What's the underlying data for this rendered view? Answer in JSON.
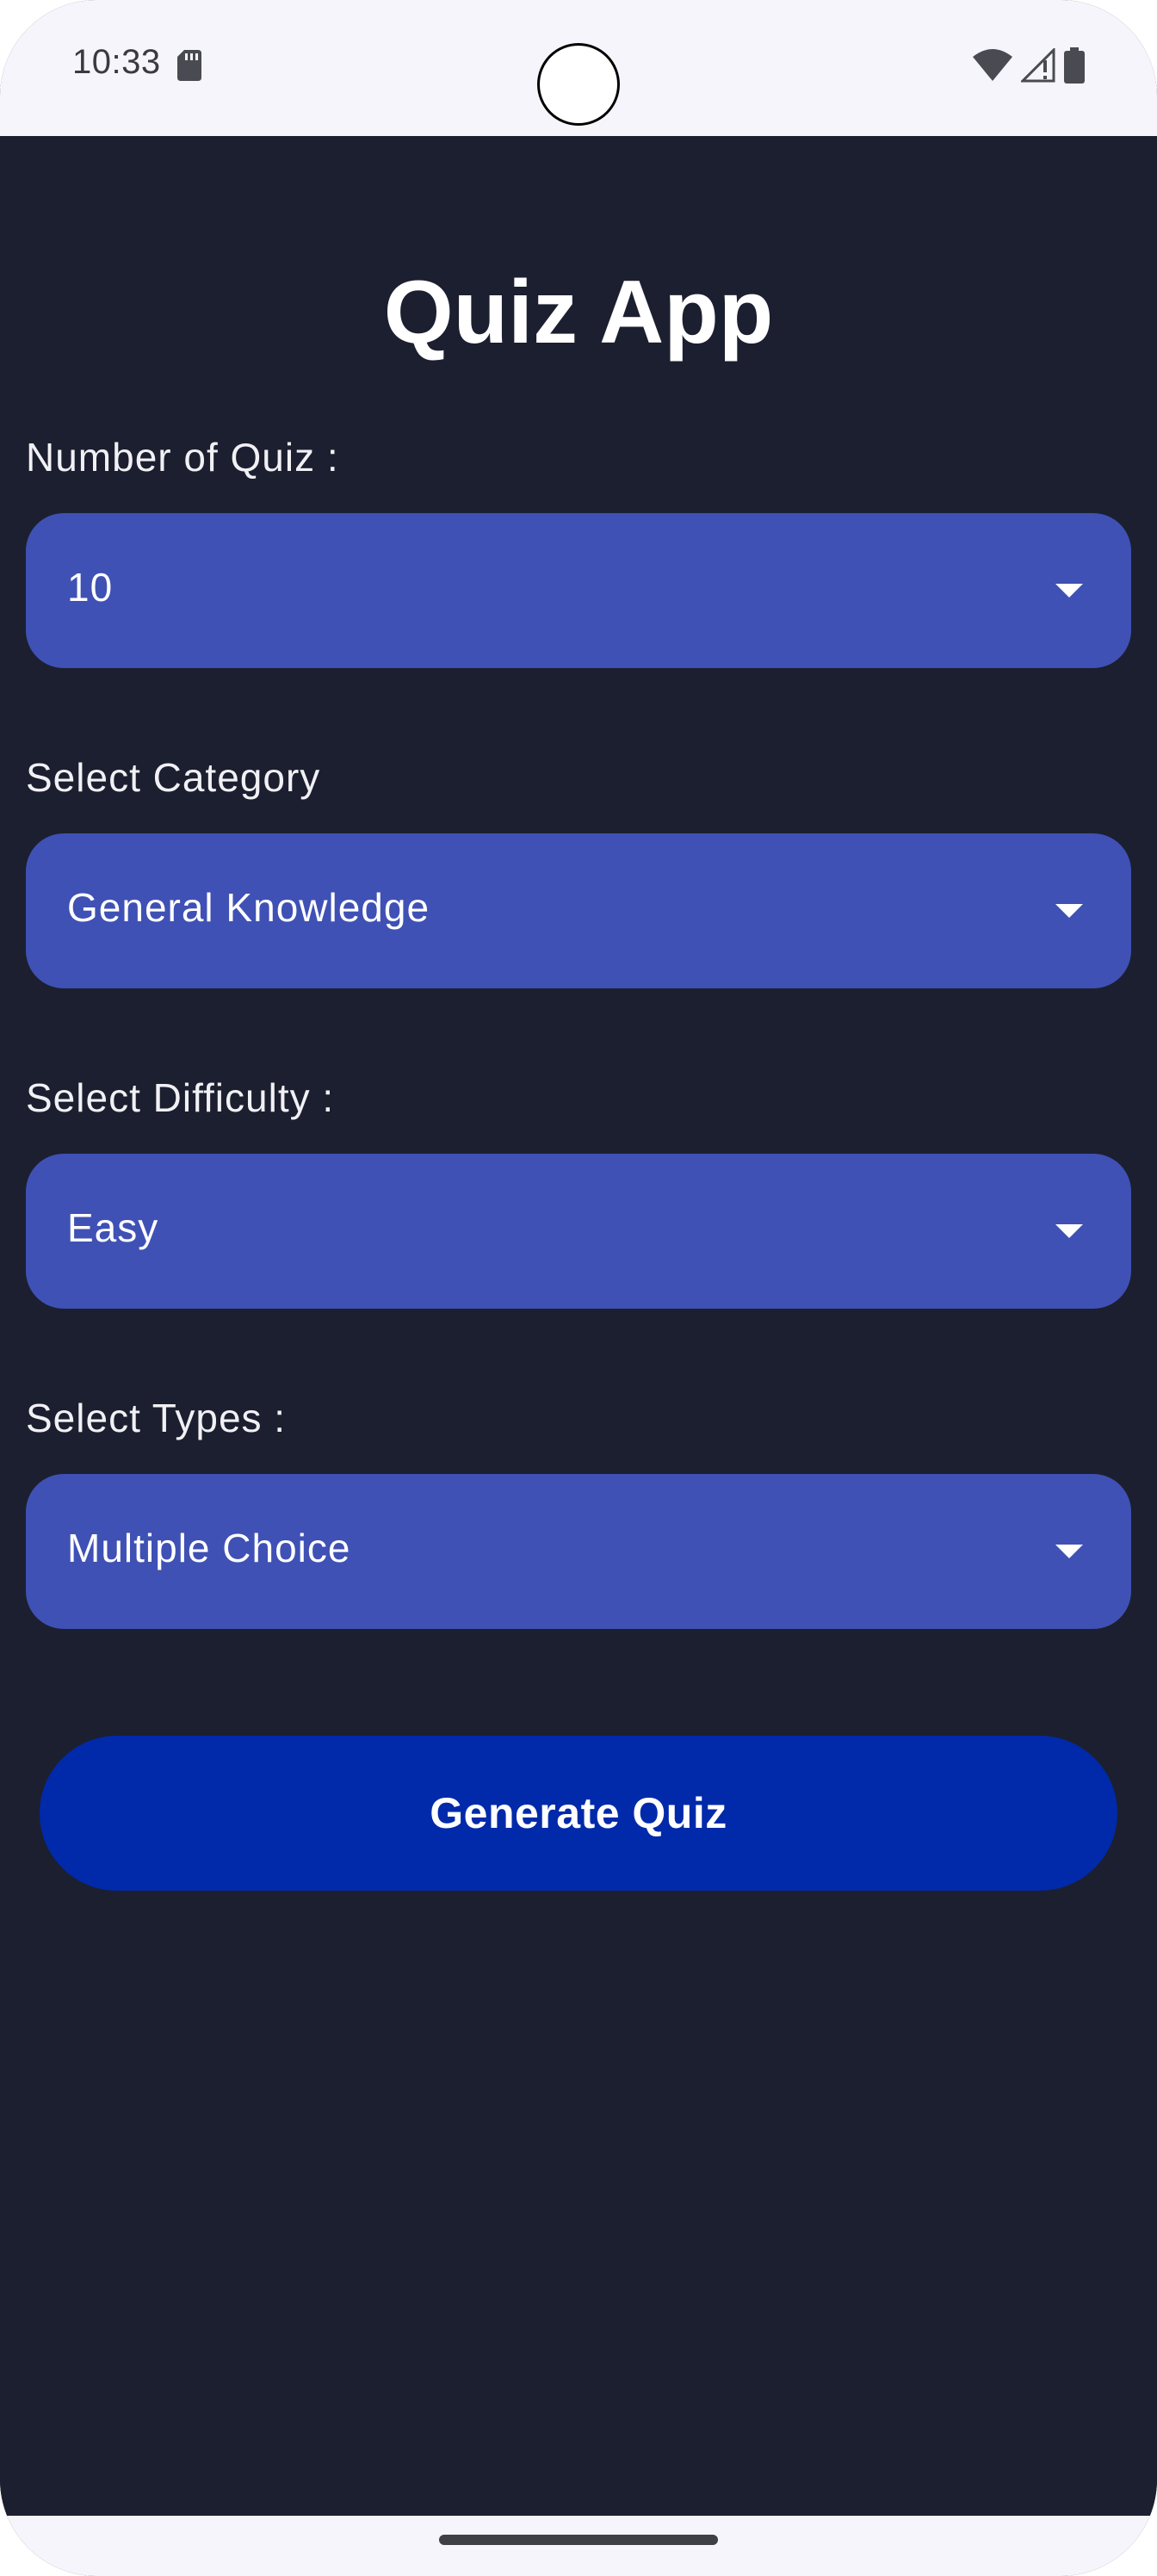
{
  "status_bar": {
    "time": "10:33",
    "icons": [
      "sd-card-icon",
      "wifi-icon",
      "signal-icon",
      "battery-icon"
    ]
  },
  "app": {
    "title": "Quiz App",
    "fields": [
      {
        "label": "Number of Quiz :",
        "value": "10"
      },
      {
        "label": "Select Category",
        "value": "General Knowledge"
      },
      {
        "label": "Select Difficulty :",
        "value": "Easy"
      },
      {
        "label": "Select Types :",
        "value": "Multiple Choice"
      }
    ],
    "generate_label": "Generate Quiz"
  },
  "colors": {
    "background": "#1c1f2f",
    "dropdown": "#3f51b5",
    "button": "#002aaa",
    "system_bars": "#f6f5fb"
  }
}
